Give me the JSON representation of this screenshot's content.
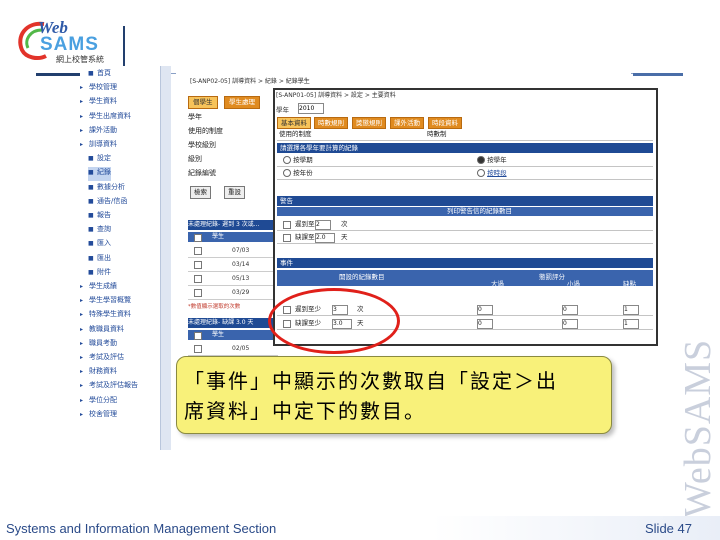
{
  "logo": {
    "web": "Web",
    "sams": "SAMS",
    "subtitle": "網上校管系統"
  },
  "sidebar": {
    "items": [
      {
        "label": "首頁",
        "type": "sub"
      },
      {
        "label": "學校管理",
        "type": "top"
      },
      {
        "label": "學生資料",
        "type": "top"
      },
      {
        "label": "學生出席資料",
        "type": "top"
      },
      {
        "label": "課外活動",
        "type": "top"
      },
      {
        "label": "訓導資料",
        "type": "top"
      },
      {
        "label": "設定",
        "type": "sub"
      },
      {
        "label": "紀錄",
        "type": "sub",
        "selected": true
      },
      {
        "label": "數據分析",
        "type": "sub"
      },
      {
        "label": "通告/信函",
        "type": "sub"
      },
      {
        "label": "報告",
        "type": "sub"
      },
      {
        "label": "查詢",
        "type": "sub"
      },
      {
        "label": "匯入",
        "type": "sub"
      },
      {
        "label": "匯出",
        "type": "sub"
      },
      {
        "label": "附件",
        "type": "sub"
      },
      {
        "label": "學生成績",
        "type": "top"
      },
      {
        "label": "學生學習概覽",
        "type": "top"
      },
      {
        "label": "特殊學生資料",
        "type": "top"
      },
      {
        "label": "教職員資料",
        "type": "top"
      },
      {
        "label": "職員考勤",
        "type": "top"
      },
      {
        "label": "考試及評估",
        "type": "top"
      },
      {
        "label": "財務資料",
        "type": "top"
      },
      {
        "label": "考試及評估報告",
        "type": "top"
      },
      {
        "label": "學位分配",
        "type": "top"
      },
      {
        "label": "校舍管理",
        "type": "top"
      }
    ]
  },
  "main": {
    "breadcrumb": "[S-ANP02-05] 訓導資料 > 紀錄 > 紀錄學生",
    "tabs": [
      "個學生",
      "學生處理"
    ],
    "form_labels": [
      "學年",
      "使用的制度",
      "學校級別",
      "級別",
      "紀錄編號"
    ],
    "buttons": [
      "檢索",
      "重設"
    ],
    "list_header": "未處理紀錄- 遲到 3 次或...",
    "list_col": "學生",
    "list_rows": [
      "07/03",
      "03/14",
      "05/13",
      "03/29"
    ],
    "list_note": "*數值顯示選取的次數",
    "list2_header": "未處理紀錄- 缺課 3.0 天",
    "list2_col": "學生",
    "list2_rows": [
      "02/05"
    ]
  },
  "inner": {
    "breadcrumb": "[S-ANP01-05] 訓導資料 > 設定 > 主要資料",
    "year_label": "學年",
    "year_value": "2010",
    "tabs": [
      "基本資料",
      "時數規則",
      "獎懲規則",
      "課外活動",
      "時段資料"
    ],
    "row1": {
      "label": "使用的制度",
      "value": "時數制"
    },
    "section1": "請選擇各學年要計算的紀錄",
    "radio": [
      "按學期",
      "按學年",
      "按年份",
      "按時段"
    ],
    "section2": "警告",
    "section2_col": "列印警告信的紀錄數目",
    "warn_rows": [
      {
        "label": "遲到至少",
        "value": "2",
        "unit": "次"
      },
      {
        "label": "缺課至少",
        "value": "2.0",
        "unit": "天"
      }
    ],
    "section3": "事件",
    "event_cols": [
      "開設的紀錄數目",
      "懲罰評分",
      "大過",
      "小過",
      "缺點"
    ],
    "event_rows": [
      {
        "label": "遲到至少",
        "value": "3",
        "unit": "次",
        "a": "0",
        "b": "0",
        "c": "1"
      },
      {
        "label": "缺課至少",
        "value": "3.0",
        "unit": "天",
        "a": "0",
        "b": "0",
        "c": "1"
      }
    ]
  },
  "callout": {
    "line1": "「事件」中顯示的次數取自「設定＞出",
    "line2": "席資料」中定下的數目。"
  },
  "footer": {
    "left": "Systems and Information Management Section",
    "right": "Slide 47"
  },
  "watermark": "WebSAMS",
  "colors": {
    "accent": "#1f4a94",
    "tab": "#e08b20",
    "callout": "#f8f17a",
    "oval": "#e0201a"
  }
}
